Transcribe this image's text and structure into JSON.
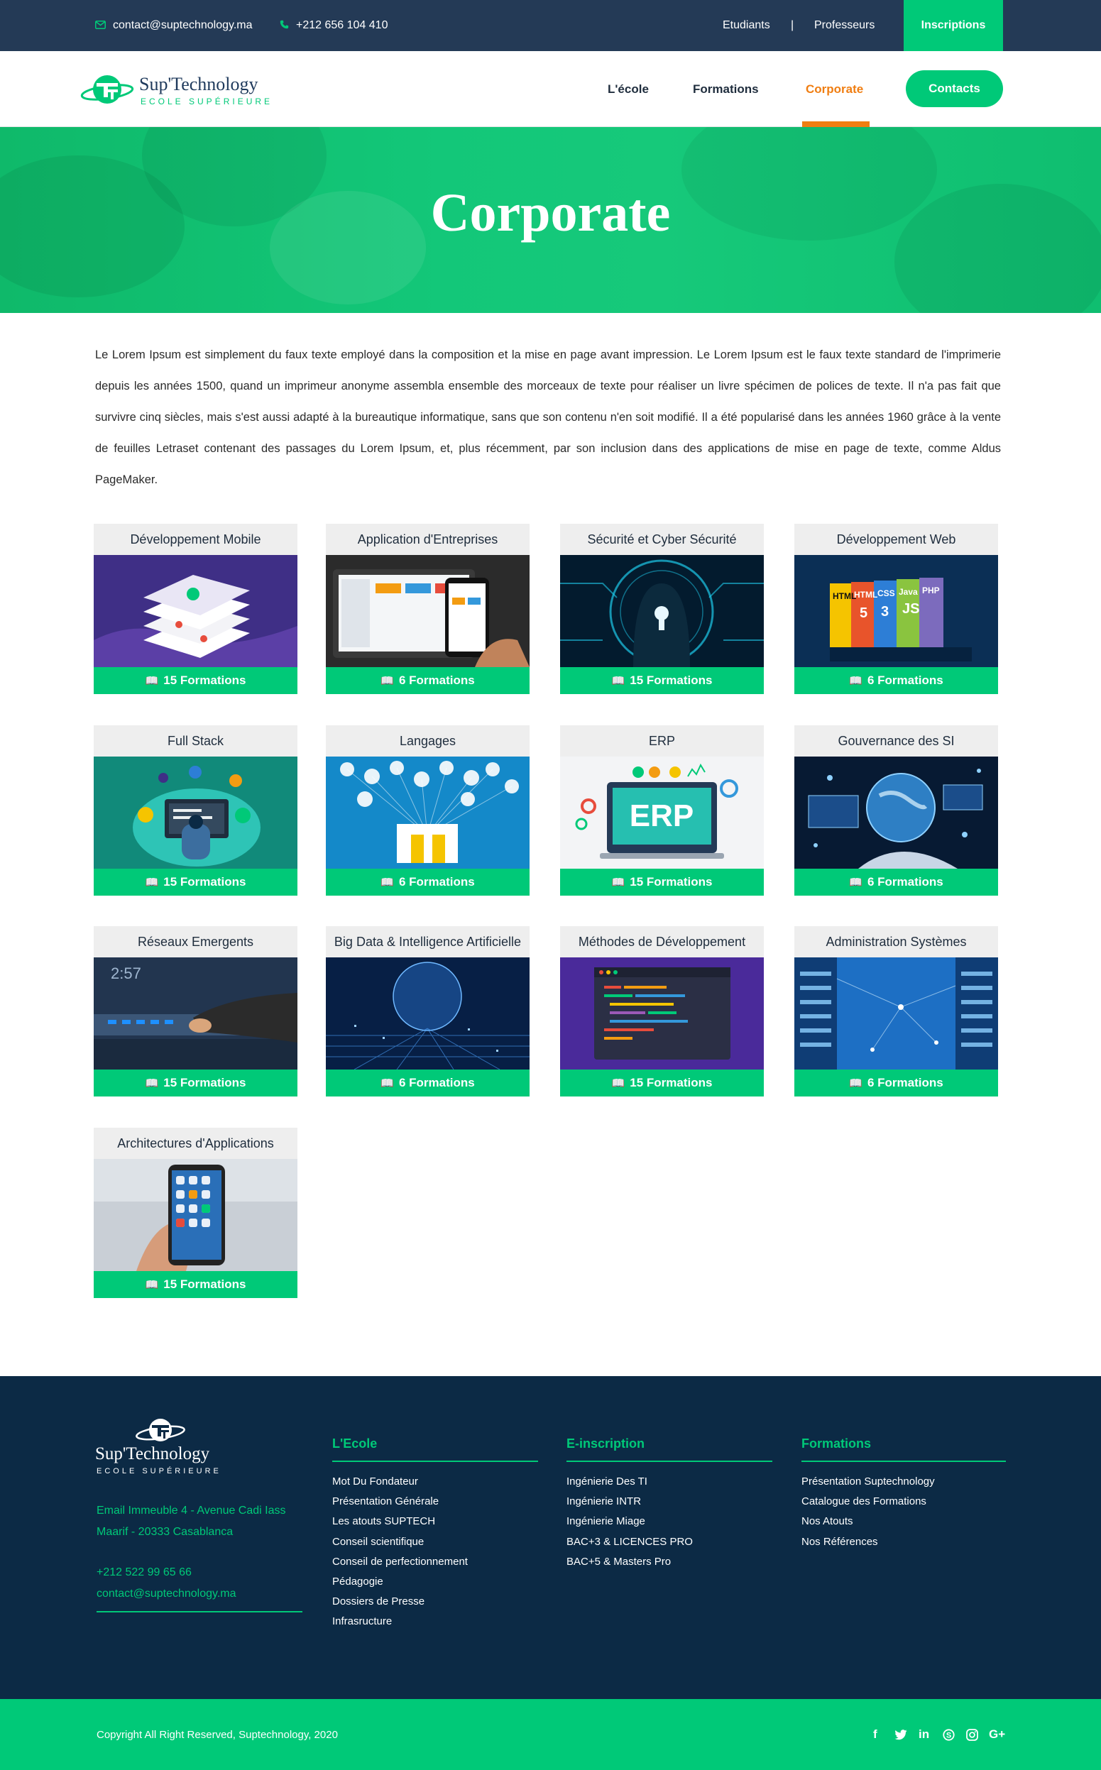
{
  "topbar": {
    "email": "contact@suptechnology.ma",
    "phone": "+212 656 104 410",
    "links": [
      "Etudiants",
      "Professeurs"
    ],
    "separator": "|",
    "cta": "Inscriptions"
  },
  "header": {
    "logo_name": "Sup'Technology",
    "logo_sub": "ECOLE SUPÉRIEURE",
    "nav": [
      "L'école",
      "Formations",
      "Corporate"
    ],
    "active_nav": "Corporate",
    "contacts_button": "Contacts"
  },
  "hero": {
    "title": "Corporate"
  },
  "intro": "Le Lorem Ipsum est simplement du faux texte employé dans la composition et la mise en page avant impression. Le Lorem Ipsum est le faux texte standard de l'imprimerie depuis les années 1500, quand un imprimeur anonyme assembla ensemble des morceaux de texte pour réaliser un livre spécimen de polices de texte. Il n'a pas fait que survivre cinq siècles, mais s'est aussi adapté à la bureautique informatique, sans que son contenu n'en soit modifié. Il a été popularisé dans les années 1960 grâce à la vente de feuilles Letraset contenant des passages du Lorem Ipsum, et, plus récemment, par son inclusion dans des applications de mise en page de texte, comme Aldus PageMaker.",
  "cards": [
    {
      "title": "Développement Mobile",
      "formations": "15 Formations",
      "icon": "book-icon"
    },
    {
      "title": "Application d'Entreprises",
      "formations": "6 Formations",
      "icon": "book-icon"
    },
    {
      "title": "Sécurité et Cyber Sécurité",
      "formations": "15 Formations",
      "icon": "book-icon"
    },
    {
      "title": "Développement Web",
      "formations": "6 Formations",
      "icon": "book-icon"
    },
    {
      "title": "Full Stack",
      "formations": "15 Formations",
      "icon": "book-icon"
    },
    {
      "title": "Langages",
      "formations": "6 Formations",
      "icon": "book-icon"
    },
    {
      "title": "ERP",
      "formations": "15 Formations",
      "icon": "book-icon"
    },
    {
      "title": "Gouvernance des SI",
      "formations": "6 Formations",
      "icon": "book-icon"
    },
    {
      "title": "Réseaux Emergents",
      "formations": "15 Formations",
      "icon": "book-icon"
    },
    {
      "title": "Big Data & Intelligence Artificielle",
      "formations": "6 Formations",
      "icon": "book-icon"
    },
    {
      "title": "Méthodes de Développement",
      "formations": "15 Formations",
      "icon": "book-icon"
    },
    {
      "title": "Administration Systèmes",
      "formations": "6 Formations",
      "icon": "book-icon"
    },
    {
      "title": "Architectures d'Applications",
      "formations": "15 Formations",
      "icon": "book-icon"
    }
  ],
  "card_image_text": {
    "web_tags": [
      "HTML",
      "HTML",
      "CSS",
      "Java",
      "PHP",
      "JS",
      "5",
      "3"
    ],
    "erp": "ERP",
    "clock": "2:57"
  },
  "footer": {
    "logo_name": "Sup'Technology",
    "logo_sub": "ECOLE SUPÉRIEURE",
    "address": [
      "Email Immeuble 4 - Avenue Cadi Iass",
      "Maarif - 20333 Casablanca"
    ],
    "phone": "+212 522 99 65 66",
    "email": "contact@suptechnology.ma",
    "columns": [
      {
        "title": "L'Ecole",
        "items": [
          "Mot Du Fondateur",
          "Présentation Générale",
          "Les atouts SUPTECH",
          "Conseil scientifique",
          "Conseil de perfectionnement",
          "Pédagogie",
          "Dossiers de Presse",
          "Infrasructure"
        ]
      },
      {
        "title": "E-inscription",
        "items": [
          "Ingénierie Des TI",
          "Ingénierie INTR",
          "Ingénierie Miage",
          "BAC+3 & LICENCES PRO",
          "BAC+5 & Masters Pro"
        ]
      },
      {
        "title": "Formations",
        "items": [
          "Présentation Suptechnology",
          "Catalogue des Formations",
          "Nos Atouts",
          "Nos Références"
        ]
      }
    ],
    "copyright": "Copyright All Right Reserved, Suptechnology, 2020",
    "social": [
      "f",
      "t",
      "in",
      "S",
      "ig",
      "G+"
    ]
  },
  "colors": {
    "green": "#00c978",
    "navy": "#243a56",
    "footer": "#0c2a45",
    "orange": "#f07e12"
  }
}
